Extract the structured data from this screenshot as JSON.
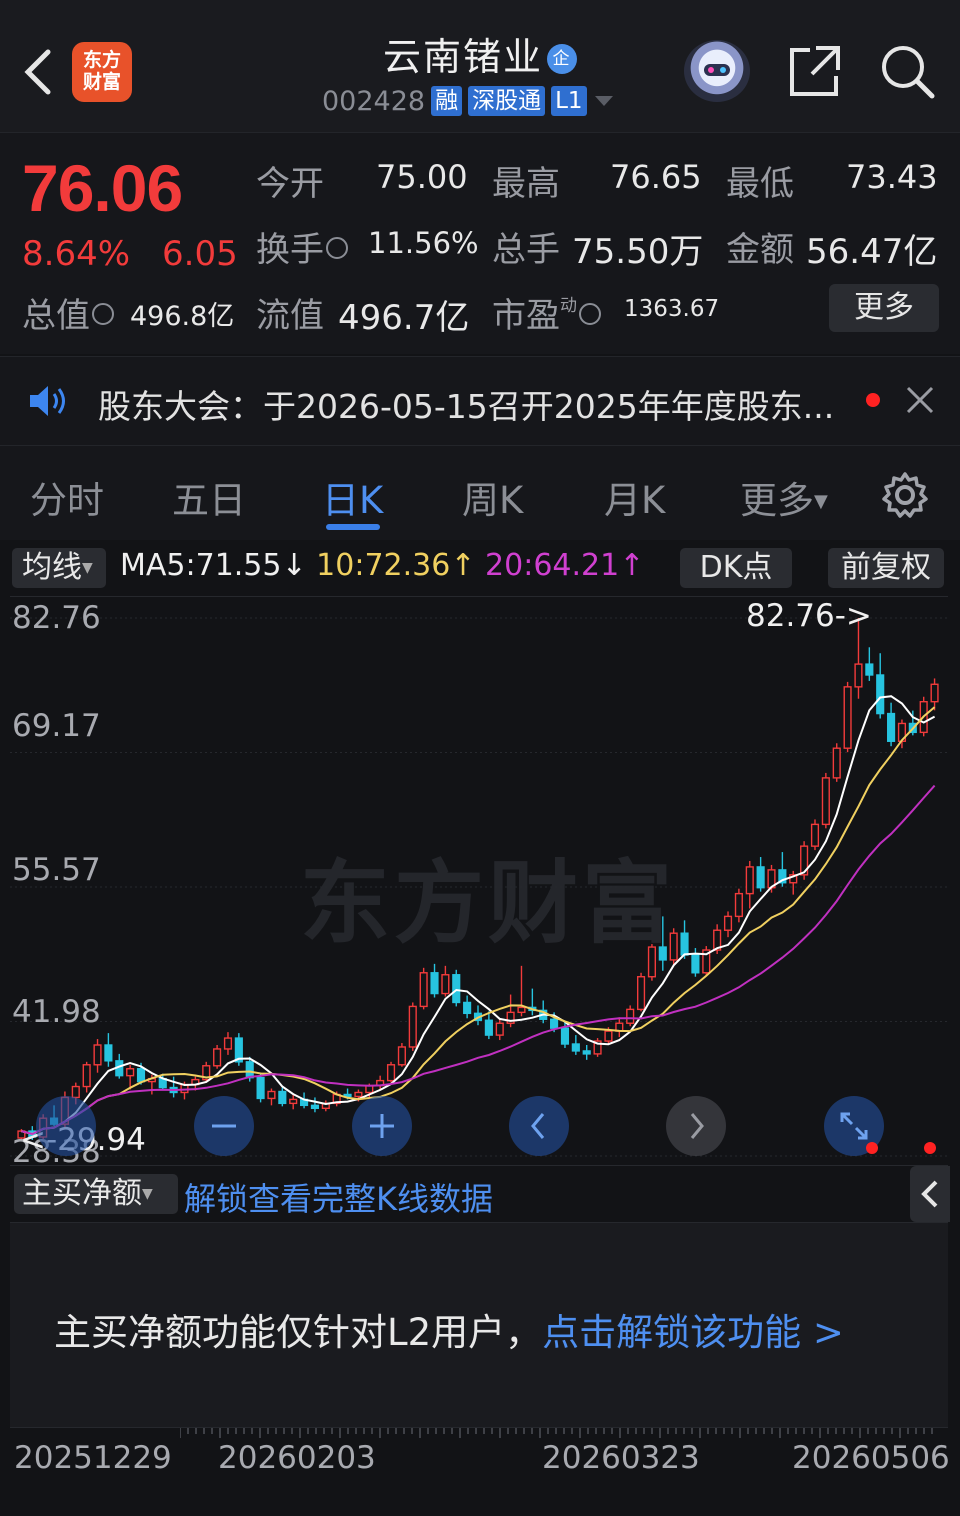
{
  "header": {
    "logo_line1": "东方",
    "logo_line2": "财富",
    "stock_name": "云南锗业",
    "badge": "企",
    "stock_code": "002428",
    "tags": [
      "融",
      "深股通",
      "L1"
    ]
  },
  "quote": {
    "price": "76.06",
    "change_pct": "8.64%",
    "change": "6.05",
    "open_label": "今开",
    "open": "75.00",
    "high_label": "最高",
    "high": "76.65",
    "low_label": "最低",
    "low": "73.43",
    "turnover_label": "换手",
    "turnover": "11.56%",
    "volume_label": "总手",
    "volume": "75.50万",
    "amount_label": "金额",
    "amount": "56.47亿",
    "mktcap_label": "总值",
    "mktcap": "496.8亿",
    "float_label": "流值",
    "float_cap": "496.7亿",
    "pe_label": "市盈",
    "pe_sup": "动",
    "pe": "1363.67",
    "more": "更多"
  },
  "notice": {
    "text": "股东大会：于2026-05-15召开2025年年度股东..."
  },
  "tabs": [
    "分时",
    "五日",
    "日K",
    "周K",
    "月K",
    "更多"
  ],
  "active_tab": "日K",
  "ma_row": {
    "selector": "均线",
    "ma5": "MA5:71.55",
    "ma10": "10:72.36",
    "ma20": "20:64.21",
    "dk": "DK点",
    "adjust": "前复权"
  },
  "chart_data": {
    "type": "candlestick",
    "y_labels": [
      "82.76",
      "69.17",
      "55.57",
      "41.98",
      "28.38"
    ],
    "ylim": [
      28.38,
      82.76
    ],
    "max_annotation": "82.76->",
    "min_annotation": "<-29.94",
    "watermark": "东方财富",
    "x_labels": [
      "20251229",
      "20260203",
      "20260323",
      "20260506"
    ],
    "series": [
      {
        "name": "MA5",
        "color": "#ffffff"
      },
      {
        "name": "MA10",
        "color": "#f0d060"
      },
      {
        "name": "MA20",
        "color": "#c030c0"
      }
    ],
    "candles": [
      [
        30.2,
        31.1,
        29.9,
        30.9
      ],
      [
        30.9,
        31.4,
        30.0,
        30.3
      ],
      [
        30.3,
        32.6,
        30.1,
        32.2
      ],
      [
        32.2,
        33.5,
        31.4,
        31.6
      ],
      [
        31.6,
        34.9,
        31.2,
        34.3
      ],
      [
        34.3,
        35.8,
        33.6,
        35.4
      ],
      [
        35.4,
        37.9,
        34.8,
        37.6
      ],
      [
        37.6,
        40.2,
        36.8,
        39.6
      ],
      [
        39.6,
        40.8,
        37.4,
        38.0
      ],
      [
        38.0,
        38.7,
        36.2,
        36.5
      ],
      [
        36.5,
        37.6,
        35.1,
        37.2
      ],
      [
        37.2,
        37.8,
        35.6,
        35.9
      ],
      [
        35.9,
        36.6,
        34.6,
        36.2
      ],
      [
        36.2,
        36.7,
        35.0,
        35.3
      ],
      [
        35.3,
        36.4,
        34.3,
        34.8
      ],
      [
        34.8,
        35.9,
        34.1,
        35.6
      ],
      [
        35.6,
        36.4,
        35.0,
        36.1
      ],
      [
        36.1,
        37.9,
        35.8,
        37.5
      ],
      [
        37.5,
        39.6,
        37.2,
        39.2
      ],
      [
        39.2,
        40.9,
        38.6,
        40.3
      ],
      [
        40.3,
        40.8,
        37.5,
        37.9
      ],
      [
        37.9,
        38.4,
        35.9,
        36.3
      ],
      [
        36.3,
        36.8,
        33.8,
        34.2
      ],
      [
        34.2,
        35.2,
        33.5,
        34.9
      ],
      [
        34.9,
        35.3,
        33.4,
        33.7
      ],
      [
        33.7,
        34.6,
        33.1,
        34.1
      ],
      [
        34.1,
        34.8,
        33.2,
        33.5
      ],
      [
        33.5,
        34.3,
        32.8,
        33.2
      ],
      [
        33.2,
        34.0,
        32.9,
        33.7
      ],
      [
        33.7,
        34.9,
        33.4,
        34.6
      ],
      [
        34.6,
        35.2,
        34.1,
        34.4
      ],
      [
        34.4,
        35.1,
        33.9,
        34.8
      ],
      [
        34.8,
        35.7,
        34.3,
        35.5
      ],
      [
        35.5,
        36.5,
        35.0,
        36.0
      ],
      [
        36.0,
        37.9,
        35.8,
        37.6
      ],
      [
        37.6,
        39.8,
        37.4,
        39.4
      ],
      [
        39.4,
        43.9,
        39.0,
        43.5
      ],
      [
        43.5,
        47.4,
        43.2,
        46.9
      ],
      [
        46.9,
        47.8,
        44.4,
        44.8
      ],
      [
        44.8,
        47.6,
        44.5,
        46.7
      ],
      [
        46.7,
        47.2,
        43.5,
        43.9
      ],
      [
        43.9,
        44.6,
        42.3,
        42.8
      ],
      [
        42.8,
        43.6,
        41.6,
        42.1
      ],
      [
        42.1,
        43.0,
        40.2,
        40.6
      ],
      [
        40.6,
        42.2,
        40.1,
        41.8
      ],
      [
        41.8,
        44.7,
        41.4,
        42.9
      ],
      [
        42.9,
        47.6,
        42.5,
        43.4
      ],
      [
        43.4,
        45.3,
        42.6,
        43.1
      ],
      [
        43.1,
        44.1,
        41.8,
        42.2
      ],
      [
        42.2,
        42.9,
        40.9,
        41.3
      ],
      [
        41.3,
        41.9,
        39.3,
        39.7
      ],
      [
        39.7,
        40.6,
        38.6,
        39.0
      ],
      [
        39.0,
        39.6,
        38.1,
        38.7
      ],
      [
        38.7,
        40.3,
        38.4,
        40.0
      ],
      [
        40.0,
        41.4,
        39.6,
        41.0
      ],
      [
        41.0,
        42.4,
        40.4,
        41.8
      ],
      [
        41.8,
        43.6,
        41.5,
        43.2
      ],
      [
        43.2,
        46.9,
        43.0,
        46.5
      ],
      [
        46.5,
        49.8,
        46.1,
        49.5
      ],
      [
        49.5,
        52.6,
        47.1,
        48.2
      ],
      [
        48.2,
        51.4,
        47.6,
        50.9
      ],
      [
        50.9,
        52.2,
        48.3,
        48.7
      ],
      [
        48.7,
        49.4,
        46.5,
        46.9
      ],
      [
        46.9,
        49.6,
        46.6,
        49.2
      ],
      [
        49.2,
        51.8,
        48.8,
        51.2
      ],
      [
        51.2,
        53.1,
        50.5,
        52.6
      ],
      [
        52.6,
        55.4,
        52.0,
        54.9
      ],
      [
        54.9,
        58.2,
        53.4,
        57.6
      ],
      [
        57.6,
        58.6,
        55.1,
        55.5
      ],
      [
        55.5,
        57.8,
        55.0,
        57.3
      ],
      [
        57.3,
        59.1,
        55.6,
        56.0
      ],
      [
        56.0,
        57.2,
        54.8,
        56.8
      ],
      [
        56.8,
        60.2,
        56.3,
        59.7
      ],
      [
        59.7,
        62.4,
        59.3,
        61.9
      ],
      [
        61.9,
        67.1,
        61.5,
        66.6
      ],
      [
        66.6,
        70.1,
        66.2,
        69.6
      ],
      [
        69.6,
        76.3,
        69.2,
        75.8
      ],
      [
        75.8,
        82.76,
        74.6,
        78.1
      ],
      [
        78.1,
        79.8,
        76.4,
        77.0
      ],
      [
        77.0,
        79.2,
        72.6,
        73.1
      ],
      [
        73.1,
        74.2,
        69.8,
        70.3
      ],
      [
        70.3,
        72.5,
        69.6,
        72.1
      ],
      [
        72.1,
        73.4,
        70.9,
        71.2
      ],
      [
        71.2,
        74.8,
        70.8,
        74.3
      ],
      [
        74.3,
        76.65,
        73.43,
        76.06
      ]
    ]
  },
  "indicator": {
    "selector": "主买净额",
    "unlock_link": "解锁查看完整K线数据",
    "message": "主买净额功能仅针对L2用户，",
    "message_link": "点击解锁该功能 >"
  }
}
